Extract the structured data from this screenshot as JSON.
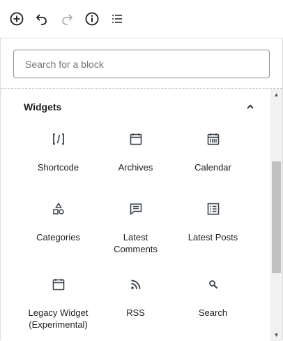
{
  "toolbar": {
    "buttons": [
      {
        "icon": "add-block-icon"
      },
      {
        "icon": "undo-icon"
      },
      {
        "icon": "redo-icon",
        "disabled": true
      },
      {
        "icon": "info-icon"
      },
      {
        "icon": "list-view-icon"
      }
    ]
  },
  "search": {
    "placeholder": "Search for a block",
    "value": ""
  },
  "section": {
    "title": "Widgets",
    "expanded": true
  },
  "blocks": [
    {
      "label": "Shortcode",
      "icon": "shortcode-icon"
    },
    {
      "label": "Archives",
      "icon": "archives-icon"
    },
    {
      "label": "Calendar",
      "icon": "calendar-icon"
    },
    {
      "label": "Categories",
      "icon": "categories-icon"
    },
    {
      "label": "Latest Comments",
      "icon": "latest-comments-icon"
    },
    {
      "label": "Latest Posts",
      "icon": "latest-posts-icon"
    },
    {
      "label": "Legacy Widget (Experimental)",
      "icon": "legacy-widget-icon"
    },
    {
      "label": "RSS",
      "icon": "rss-icon"
    },
    {
      "label": "Search",
      "icon": "search-icon"
    }
  ],
  "colors": {
    "text": "#1e1e1e",
    "placeholder": "#757575",
    "border": "#8c8f94",
    "scroll_thumb": "#c1c1c1"
  }
}
